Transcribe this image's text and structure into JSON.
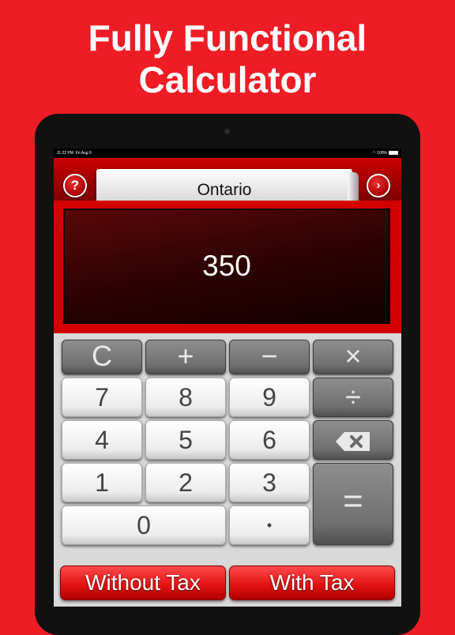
{
  "headline": {
    "line1": "Fully Functional",
    "line2": "Calculator"
  },
  "status_bar": {
    "time": "11:22 PM",
    "date": "Fri Aug 9",
    "wifi_icon": "wifi-icon",
    "battery": "100%"
  },
  "header": {
    "region": "Ontario",
    "help_label": "?",
    "next_label": "›"
  },
  "display": {
    "value": "350"
  },
  "keys": {
    "clear": "C",
    "plus": "+",
    "minus": "−",
    "multiply": "×",
    "divide": "÷",
    "backspace_icon": "backspace-icon",
    "seven": "7",
    "eight": "8",
    "nine": "9",
    "four": "4",
    "five": "5",
    "six": "6",
    "one": "1",
    "two": "2",
    "three": "3",
    "zero": "0",
    "decimal": "•",
    "equals": "="
  },
  "buttons": {
    "without_tax": "Without Tax",
    "with_tax": "With Tax"
  },
  "colors": {
    "brand_red": "#ee1c25",
    "display_dark": "#2a0202"
  }
}
